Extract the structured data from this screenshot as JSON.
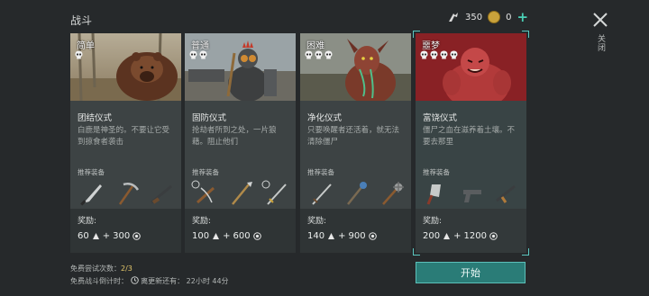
{
  "header": {
    "title": "战斗",
    "energy_value": "350",
    "coins_value": "0",
    "plus_symbol": "+",
    "close_label": "关闭"
  },
  "cards": [
    {
      "difficulty": "简单",
      "skulls": 1,
      "name": "团结仪式",
      "description": "白鹿是神圣的。不要让它受到掠食者袭击",
      "recommend_label": "推荐装备",
      "equipment": [
        "machete-icon",
        "pickaxe-icon",
        "rifle-icon"
      ],
      "reward_label": "奖励:",
      "reward_xp": "60",
      "reward_plus": "+",
      "reward_tokens": "300",
      "image_subject": "bear"
    },
    {
      "difficulty": "普通",
      "skulls": 2,
      "name": "固防仪式",
      "description": "抢劫者所到之处，一片狼藉。阻止他们",
      "recommend_label": "推荐装备",
      "equipment": [
        "crossbow-icon",
        "spear-icon",
        "sword-icon"
      ],
      "reward_label": "奖励:",
      "reward_xp": "100",
      "reward_plus": "+",
      "reward_tokens": "600",
      "image_subject": "raider"
    },
    {
      "difficulty": "困难",
      "skulls": 3,
      "name": "净化仪式",
      "description": "只要唤醒者还活着，就无法清除僵尸",
      "recommend_label": "推荐装备",
      "equipment": [
        "sword-icon",
        "staff-icon",
        "mace-icon"
      ],
      "reward_label": "奖励:",
      "reward_xp": "140",
      "reward_plus": "+",
      "reward_tokens": "900",
      "image_subject": "awakener"
    },
    {
      "difficulty": "噩梦",
      "skulls": 4,
      "name": "富饶仪式",
      "description": "僵尸之血在滋养着土壤。不要去那里",
      "recommend_label": "推荐装备",
      "equipment": [
        "cleaver-icon",
        "pistol-icon",
        "smg-icon"
      ],
      "reward_label": "奖励:",
      "reward_xp": "200",
      "reward_plus": "+",
      "reward_tokens": "1200",
      "image_subject": "brute",
      "selected": true
    }
  ],
  "footer": {
    "free_attempts_label": "免费尝试次数：",
    "free_attempts_value": "2/3",
    "countdown_label": "免费战斗倒计时：",
    "renew_label": "离更新还有：",
    "renew_time": "22小时 44分",
    "start_button": "开始"
  },
  "colors": {
    "accent": "#5bc7c0",
    "start_button": "#2a7c77",
    "nightmare_header": "#8c1f24",
    "highlight": "#e2c66a"
  }
}
